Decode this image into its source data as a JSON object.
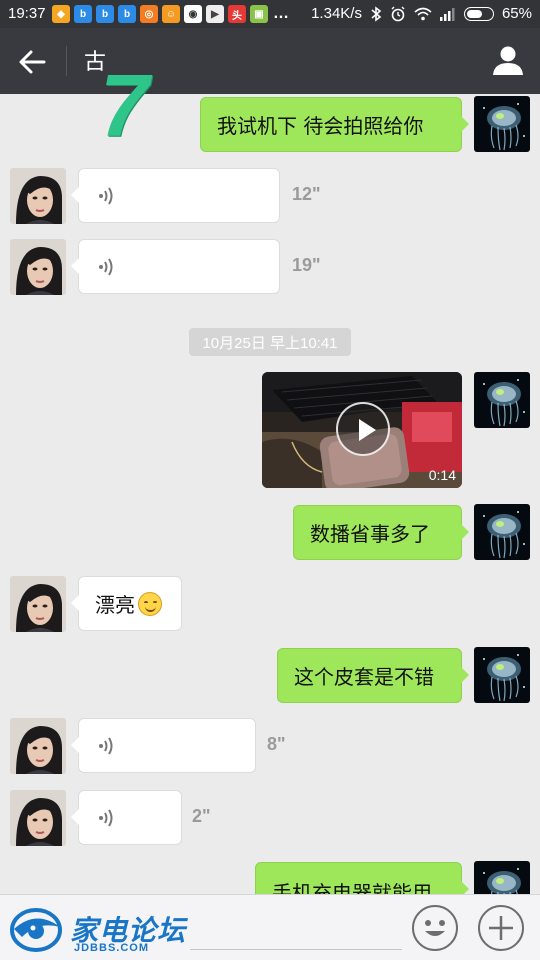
{
  "status_bar": {
    "time": "19:37",
    "net_speed": "1.34K/s",
    "battery": "65%",
    "battery_level": 0.65
  },
  "header": {
    "title": "古"
  },
  "overlay": {
    "number": "7"
  },
  "messages": [
    {
      "side": "me",
      "type": "text",
      "text": "我试机下  待会拍照给你"
    },
    {
      "side": "them",
      "type": "voice",
      "duration": "12\""
    },
    {
      "side": "them",
      "type": "voice",
      "duration": "19\""
    },
    {
      "type": "timestamp",
      "text": "10月25日 早上10:41"
    },
    {
      "side": "me",
      "type": "video",
      "duration": "0:14"
    },
    {
      "side": "me",
      "type": "text",
      "text": "数播省事多了"
    },
    {
      "side": "them",
      "type": "text",
      "text": "漂亮",
      "emoji": "smile-emoji"
    },
    {
      "side": "me",
      "type": "text",
      "text": "这个皮套是不错"
    },
    {
      "side": "them",
      "type": "voice",
      "duration": "8\""
    },
    {
      "side": "them",
      "type": "voice",
      "duration": "2\""
    },
    {
      "side": "me",
      "type": "text",
      "text": "手机充电器就能用"
    }
  ],
  "bottom_bar": {
    "logo_text": "家电论坛",
    "logo_sub": "JDBBS.COM"
  },
  "colors": {
    "header_bg": "#393a3f",
    "status_bg": "#333438",
    "chat_bg": "#ebebeb",
    "my_bubble": "#9fe75a",
    "their_bubble": "#ffffff",
    "logo_blue": "#1976c6"
  }
}
